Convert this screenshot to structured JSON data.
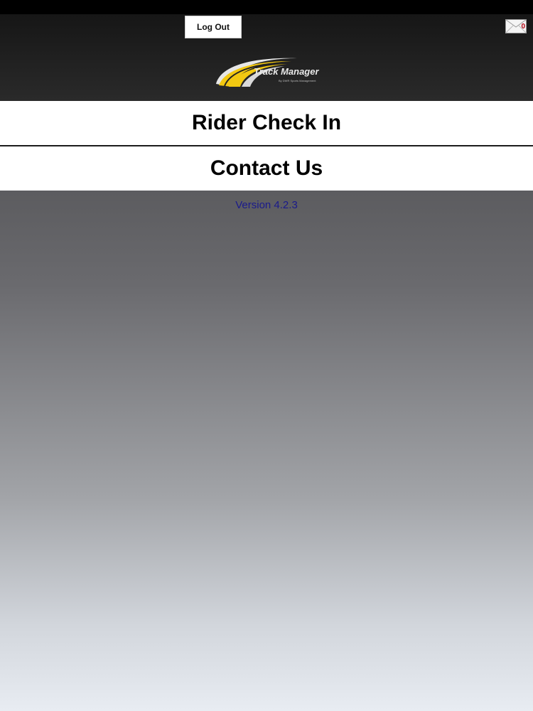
{
  "header": {
    "logout_label": "Log Out",
    "mail_count": "0",
    "logo": {
      "title": "Track Manager",
      "subtitle": "By DWR Sports Management"
    }
  },
  "menu": {
    "items": [
      {
        "label": "Rider Check In"
      },
      {
        "label": "Contact Us"
      }
    ]
  },
  "version_text": "Version 4.2.3",
  "colors": {
    "header_bg": "#1e1e1e",
    "logo_yellow": "#f2c811",
    "version_text": "#1a1a8c",
    "mail_badge": "#b00010"
  }
}
